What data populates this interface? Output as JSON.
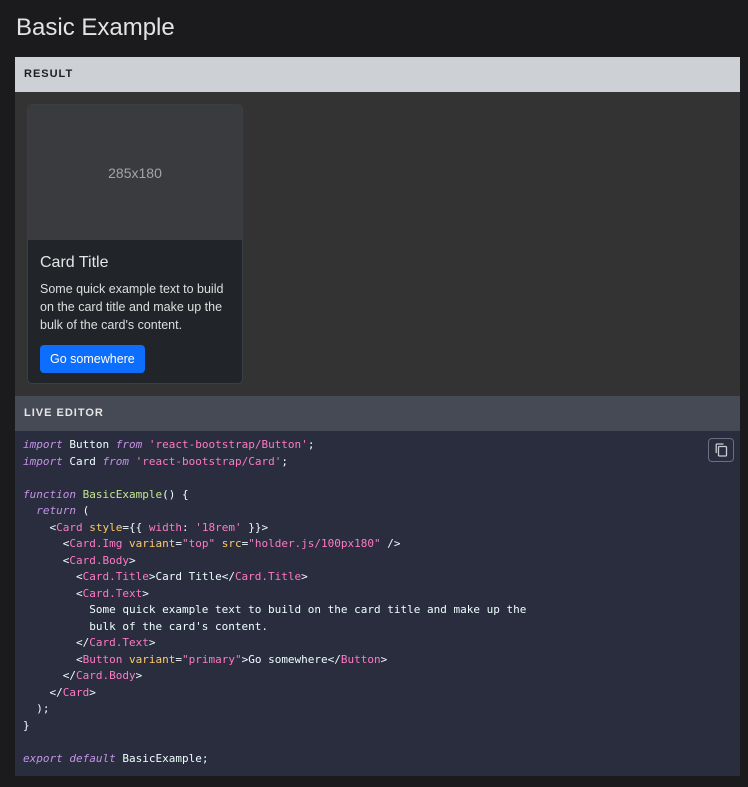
{
  "page": {
    "title": "Basic Example"
  },
  "result": {
    "header": "RESULT",
    "card": {
      "image_text": "285x180",
      "title": "Card Title",
      "text": "Some quick example text to build on the card title and make up the bulk of the card's content.",
      "button_label": "Go somewhere"
    }
  },
  "editor": {
    "header": "LIVE EDITOR",
    "copy_icon": "copy-icon",
    "lines": [
      [
        {
          "t": "import",
          "c": "kw"
        },
        {
          "t": " Button ",
          "c": "plain"
        },
        {
          "t": "from",
          "c": "kw"
        },
        {
          "t": " 'react-bootstrap/Button'",
          "c": "pink"
        },
        {
          "t": ";",
          "c": "plain"
        }
      ],
      [
        {
          "t": "import",
          "c": "kw"
        },
        {
          "t": " Card ",
          "c": "plain"
        },
        {
          "t": "from",
          "c": "kw"
        },
        {
          "t": " 'react-bootstrap/Card'",
          "c": "pink"
        },
        {
          "t": ";",
          "c": "plain"
        }
      ],
      [],
      [
        {
          "t": "function",
          "c": "kw"
        },
        {
          "t": " ",
          "c": "plain"
        },
        {
          "t": "BasicExample",
          "c": "fn2"
        },
        {
          "t": "() {",
          "c": "plain"
        }
      ],
      [
        {
          "t": "  ",
          "c": "plain"
        },
        {
          "t": "return",
          "c": "kw"
        },
        {
          "t": " (",
          "c": "plain"
        }
      ],
      [
        {
          "t": "    <",
          "c": "plain"
        },
        {
          "t": "Card",
          "c": "pink"
        },
        {
          "t": " ",
          "c": "plain"
        },
        {
          "t": "style",
          "c": "attr"
        },
        {
          "t": "={{ ",
          "c": "plain"
        },
        {
          "t": "width",
          "c": "pink"
        },
        {
          "t": ": ",
          "c": "plain"
        },
        {
          "t": "'18rem'",
          "c": "pink"
        },
        {
          "t": " }}>",
          "c": "plain"
        }
      ],
      [
        {
          "t": "      <",
          "c": "plain"
        },
        {
          "t": "Card.Img",
          "c": "pink"
        },
        {
          "t": " ",
          "c": "plain"
        },
        {
          "t": "variant",
          "c": "attr"
        },
        {
          "t": "=",
          "c": "plain"
        },
        {
          "t": "\"top\"",
          "c": "pink"
        },
        {
          "t": " ",
          "c": "plain"
        },
        {
          "t": "src",
          "c": "attr"
        },
        {
          "t": "=",
          "c": "plain"
        },
        {
          "t": "\"holder.js/100px180\"",
          "c": "pink"
        },
        {
          "t": " />",
          "c": "plain"
        }
      ],
      [
        {
          "t": "      <",
          "c": "plain"
        },
        {
          "t": "Card.Body",
          "c": "pink"
        },
        {
          "t": ">",
          "c": "plain"
        }
      ],
      [
        {
          "t": "        <",
          "c": "plain"
        },
        {
          "t": "Card.Title",
          "c": "pink"
        },
        {
          "t": ">Card Title</",
          "c": "plain"
        },
        {
          "t": "Card.Title",
          "c": "pink"
        },
        {
          "t": ">",
          "c": "plain"
        }
      ],
      [
        {
          "t": "        <",
          "c": "plain"
        },
        {
          "t": "Card.Text",
          "c": "pink"
        },
        {
          "t": ">",
          "c": "plain"
        }
      ],
      [
        {
          "t": "          Some quick example text to build on the card title and make up the",
          "c": "plain"
        }
      ],
      [
        {
          "t": "          bulk of the card's content.",
          "c": "plain"
        }
      ],
      [
        {
          "t": "        </",
          "c": "plain"
        },
        {
          "t": "Card.Text",
          "c": "pink"
        },
        {
          "t": ">",
          "c": "plain"
        }
      ],
      [
        {
          "t": "        <",
          "c": "plain"
        },
        {
          "t": "Button",
          "c": "pink"
        },
        {
          "t": " ",
          "c": "plain"
        },
        {
          "t": "variant",
          "c": "attr"
        },
        {
          "t": "=",
          "c": "plain"
        },
        {
          "t": "\"primary\"",
          "c": "pink"
        },
        {
          "t": ">Go somewhere</",
          "c": "plain"
        },
        {
          "t": "Button",
          "c": "pink"
        },
        {
          "t": ">",
          "c": "plain"
        }
      ],
      [
        {
          "t": "      </",
          "c": "plain"
        },
        {
          "t": "Card.Body",
          "c": "pink"
        },
        {
          "t": ">",
          "c": "plain"
        }
      ],
      [
        {
          "t": "    </",
          "c": "plain"
        },
        {
          "t": "Card",
          "c": "pink"
        },
        {
          "t": ">",
          "c": "plain"
        }
      ],
      [
        {
          "t": "  );",
          "c": "plain"
        }
      ],
      [
        {
          "t": "}",
          "c": "plain"
        }
      ],
      [],
      [
        {
          "t": "export",
          "c": "kw"
        },
        {
          "t": " ",
          "c": "plain"
        },
        {
          "t": "default",
          "c": "kw"
        },
        {
          "t": " BasicExample;",
          "c": "plain"
        }
      ]
    ]
  }
}
